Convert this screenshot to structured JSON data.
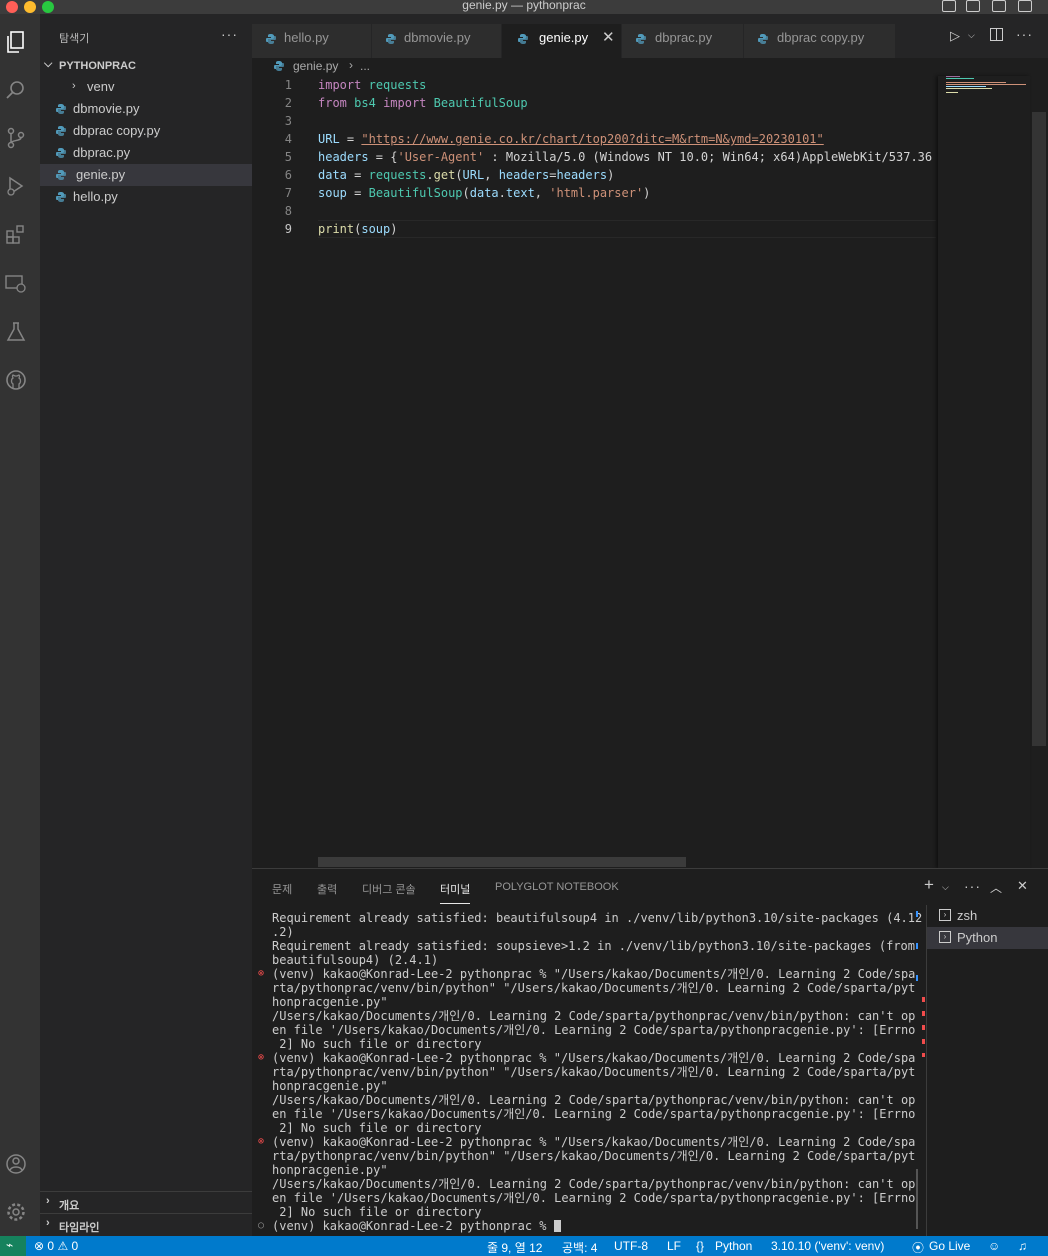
{
  "window": {
    "title": "genie.py — pythonprac"
  },
  "sidebar": {
    "title": "탐색기",
    "more": "···",
    "folder": "PYTHONPRAC",
    "items": [
      {
        "label": "venv",
        "type": "folder"
      },
      {
        "label": "dbmovie.py",
        "type": "file"
      },
      {
        "label": "dbprac copy.py",
        "type": "file"
      },
      {
        "label": "dbprac.py",
        "type": "file"
      },
      {
        "label": "genie.py",
        "type": "file",
        "selected": true
      },
      {
        "label": "hello.py",
        "type": "file"
      }
    ],
    "outline": "개요",
    "timeline": "타임라인"
  },
  "tabs": [
    {
      "label": "hello.py"
    },
    {
      "label": "dbmovie.py"
    },
    {
      "label": "genie.py",
      "active": true
    },
    {
      "label": "dbprac.py"
    },
    {
      "label": "dbprac copy.py"
    }
  ],
  "breadcrumb": {
    "file": "genie.py",
    "rest": "..."
  },
  "editor": {
    "line_numbers": [
      "1",
      "2",
      "3",
      "4",
      "5",
      "6",
      "7",
      "8",
      "9"
    ],
    "lines": [
      "import requests",
      "from bs4 import BeautifulSoup",
      "",
      "URL = \"https://www.genie.co.kr/chart/top200?ditc=M&rtm=N&ymd=20230101\"",
      "headers = {'User-Agent' : 'Mozilla/5.0 (Windows NT 10.0; Win64; x64)AppleWebKit/537.36",
      "data = requests.get(URL, headers=headers)",
      "soup = BeautifulSoup(data.text, 'html.parser')",
      "",
      "print(soup)"
    ]
  },
  "panel": {
    "tabs": [
      "문제",
      "출력",
      "디버그 콘솔",
      "터미널",
      "POLYGLOT NOTEBOOK"
    ],
    "active_tab": "터미널",
    "terminals": [
      "zsh",
      "Python"
    ],
    "terminal_lines": [
      "Requirement already satisfied: beautifulsoup4 in ./venv/lib/python3.10/site-packages (4.12",
      ".2)",
      "Requirement already satisfied: soupsieve>1.2 in ./venv/lib/python3.10/site-packages (from",
      "beautifulsoup4) (2.4.1)",
      "(venv) kakao@Konrad-Lee-2 pythonprac % \"/Users/kakao/Documents/개인/0. Learning 2 Code/spa",
      "rta/pythonprac/venv/bin/python\" \"/Users/kakao/Documents/개인/0. Learning 2 Code/sparta/pyt",
      "honpracgenie.py\"",
      "/Users/kakao/Documents/개인/0. Learning 2 Code/sparta/pythonprac/venv/bin/python: can't op",
      "en file '/Users/kakao/Documents/개인/0. Learning 2 Code/sparta/pythonpracgenie.py': [Errno",
      " 2] No such file or directory",
      "(venv) kakao@Konrad-Lee-2 pythonprac % \"/Users/kakao/Documents/개인/0. Learning 2 Code/spa",
      "rta/pythonprac/venv/bin/python\" \"/Users/kakao/Documents/개인/0. Learning 2 Code/sparta/pyt",
      "honpracgenie.py\"",
      "/Users/kakao/Documents/개인/0. Learning 2 Code/sparta/pythonprac/venv/bin/python: can't op",
      "en file '/Users/kakao/Documents/개인/0. Learning 2 Code/sparta/pythonpracgenie.py': [Errno",
      " 2] No such file or directory",
      "(venv) kakao@Konrad-Lee-2 pythonprac % \"/Users/kakao/Documents/개인/0. Learning 2 Code/spa",
      "rta/pythonprac/venv/bin/python\" \"/Users/kakao/Documents/개인/0. Learning 2 Code/sparta/pyt",
      "honpracgenie.py\"",
      "/Users/kakao/Documents/개인/0. Learning 2 Code/sparta/pythonprac/venv/bin/python: can't op",
      "en file '/Users/kakao/Documents/개인/0. Learning 2 Code/sparta/pythonpracgenie.py': [Errno",
      " 2] No such file or directory",
      "(venv) kakao@Konrad-Lee-2 pythonprac % "
    ]
  },
  "statusbar": {
    "errors": "0",
    "warnings": "0",
    "cursor_pos": "줄 9, 열 12",
    "indent": "공백: 4",
    "encoding": "UTF-8",
    "eol": "LF",
    "language": "Python",
    "interpreter": "3.10.10 ('venv': venv)",
    "go_live": "Go Live"
  },
  "colors": {
    "statusbar": "#007acc",
    "activitybar": "#333333",
    "sidebar": "#252526",
    "editor": "#1e1e1e",
    "python_icon": "#519aba",
    "error": "#f14c4c"
  }
}
